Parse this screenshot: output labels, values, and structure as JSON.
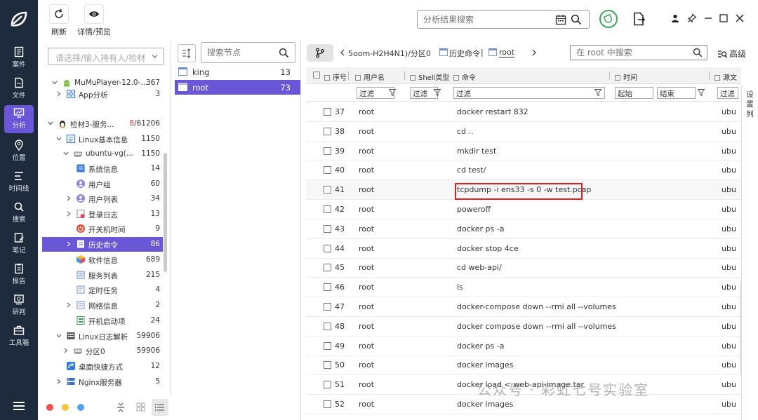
{
  "toolbar": {
    "refresh_label": "刷新",
    "details_label": "详情/预览",
    "result_search_placeholder": "分析结果搜索"
  },
  "rail": {
    "items": [
      {
        "label": "案件",
        "icon": "case-icon"
      },
      {
        "label": "文件",
        "icon": "file-icon"
      },
      {
        "label": "分析",
        "icon": "analysis-icon"
      },
      {
        "label": "位置",
        "icon": "location-icon"
      },
      {
        "label": "时间线",
        "icon": "timeline-icon"
      },
      {
        "label": "搜索",
        "icon": "search-icon"
      },
      {
        "label": "笔记",
        "icon": "notes-icon"
      },
      {
        "label": "报告",
        "icon": "report-icon"
      },
      {
        "label": "研判",
        "icon": "judge-icon"
      },
      {
        "label": "工具箱",
        "icon": "toolbox-icon"
      }
    ],
    "active_index": 2,
    "accent": "#6a57d8"
  },
  "tree": {
    "owner_placeholder": "请选择/输入持有人/检材",
    "rows": [
      {
        "label": "MuMuPlayer-12.0-...",
        "count": "367"
      },
      {
        "label": "App分析",
        "count": "3"
      },
      {
        "label": "检材3-服务...",
        "count": "8/61206",
        "count_red": "8"
      },
      {
        "label": "Linux基本信息",
        "count": "1150"
      },
      {
        "label": "ubuntu-vg(...",
        "count": "1150"
      },
      {
        "label": "系统信息",
        "count": "14"
      },
      {
        "label": "用户组",
        "count": "60"
      },
      {
        "label": "用户列表",
        "count": "34"
      },
      {
        "label": "登录日志",
        "count": "13"
      },
      {
        "label": "开关机时间",
        "count": "9"
      },
      {
        "label": "历史命令",
        "count": "86"
      },
      {
        "label": "软件信息",
        "count": "689"
      },
      {
        "label": "服务列表",
        "count": "215"
      },
      {
        "label": "定时任务",
        "count": "4"
      },
      {
        "label": "网络信息",
        "count": "2"
      },
      {
        "label": "开机启动项",
        "count": "24"
      },
      {
        "label": "Linux日志解析",
        "count": "59906"
      },
      {
        "label": "分区0",
        "count": "59906"
      },
      {
        "label": "桌面快捷方式",
        "count": "12"
      },
      {
        "label": "Nginx服务器",
        "count": "5"
      }
    ]
  },
  "nodes": {
    "search_placeholder": "搜索节点",
    "items": [
      {
        "label": "king",
        "count": "13"
      },
      {
        "label": "root",
        "count": "73"
      }
    ]
  },
  "breadcrumb": {
    "part1": "5oom-H2H4N1)/分区0",
    "part2": "历史命令",
    "part3": "root"
  },
  "table_search_placeholder": "在 root 中搜索",
  "advanced_label": "高级",
  "table": {
    "headers": {
      "seq": "序号",
      "user": "用户名",
      "shell": "Shell类型",
      "cmd": "命令",
      "time": "时间",
      "src": "源文"
    },
    "filter_label": "过滤",
    "start_label": "起始",
    "end_label": "结束",
    "rows": [
      {
        "seq": "37",
        "user": "root",
        "cmd": "docker restart 832",
        "src": "ubu"
      },
      {
        "seq": "38",
        "user": "root",
        "cmd": "cd ..",
        "src": "ubu"
      },
      {
        "seq": "39",
        "user": "root",
        "cmd": "mkdir test",
        "src": "ubu"
      },
      {
        "seq": "40",
        "user": "root",
        "cmd": "cd test/",
        "src": "ubu"
      },
      {
        "seq": "41",
        "user": "root",
        "cmd": "tcpdump -i ens33 -s 0 -w test.pcap",
        "src": "ubu"
      },
      {
        "seq": "42",
        "user": "root",
        "cmd": "poweroff",
        "src": "ubu"
      },
      {
        "seq": "43",
        "user": "root",
        "cmd": "docker ps -a",
        "src": "ubu"
      },
      {
        "seq": "44",
        "user": "root",
        "cmd": "docker stop 4ce",
        "src": "ubu"
      },
      {
        "seq": "45",
        "user": "root",
        "cmd": "cd web-api/",
        "src": "ubu"
      },
      {
        "seq": "46",
        "user": "root",
        "cmd": "ls",
        "src": "ubu"
      },
      {
        "seq": "47",
        "user": "root",
        "cmd": "docker-compose down --rmi all --volumes",
        "src": "ubu"
      },
      {
        "seq": "48",
        "user": "root",
        "cmd": "docker compose down --rmi all --volumes",
        "src": "ubu"
      },
      {
        "seq": "49",
        "user": "root",
        "cmd": "docker ps -a",
        "src": "ubu"
      },
      {
        "seq": "50",
        "user": "root",
        "cmd": "docker images",
        "src": "ubu"
      },
      {
        "seq": "51",
        "user": "root",
        "cmd": "docker load < web-api-image.tar",
        "src": "ubu"
      },
      {
        "seq": "52",
        "user": "root",
        "cmd": "docker images",
        "src": "ubu"
      }
    ]
  },
  "settings_col_label": "设置列",
  "watermark": "公众号 · 彩虹七号实验室"
}
